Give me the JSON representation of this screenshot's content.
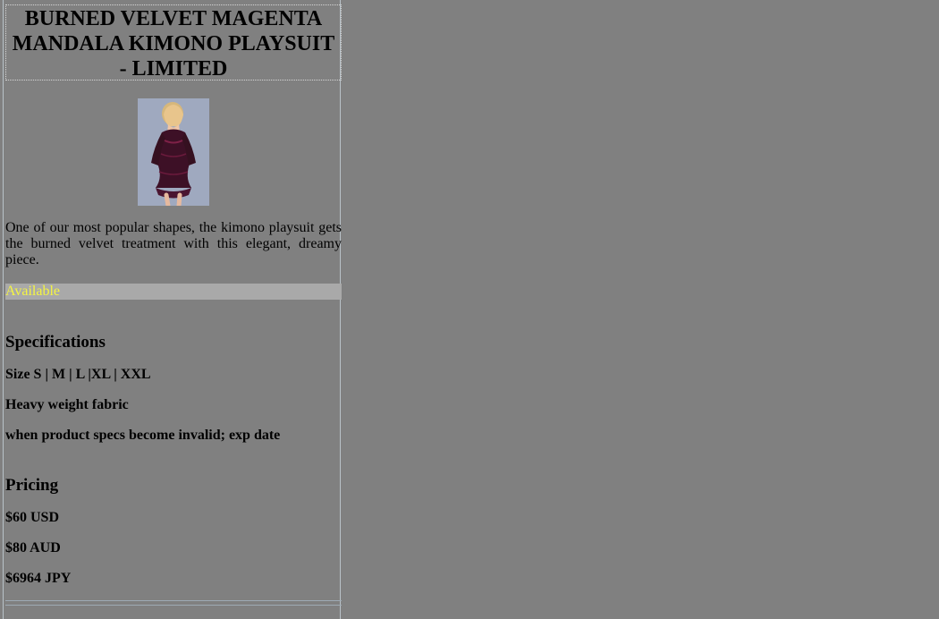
{
  "product": {
    "title": "BURNED VELVET MAGENTA MANDALA KIMONO PLAYSUIT - LIMITED",
    "description": "One of our most popular shapes, the kimono playsuit gets the burned velvet treatment with this elegant, dreamy piece.",
    "availability": "Available"
  },
  "specifications": {
    "title": "Specifications",
    "items": [
      "Size S | M | L |XL | XXL",
      "Heavy weight fabric",
      "when product specs become invalid; exp date"
    ]
  },
  "pricing": {
    "title": "Pricing",
    "items": [
      "$60 USD",
      "$80 AUD",
      "$6964 JPY"
    ]
  },
  "colors": {
    "page_background": "#808080",
    "availability_background": "#a9a9a9",
    "availability_text": "#f5f541",
    "image_background": "#98a3ba",
    "dress": "#3d1026",
    "hair": "#d6b77b"
  },
  "icons": {
    "product_image": "product-photo-icon"
  }
}
